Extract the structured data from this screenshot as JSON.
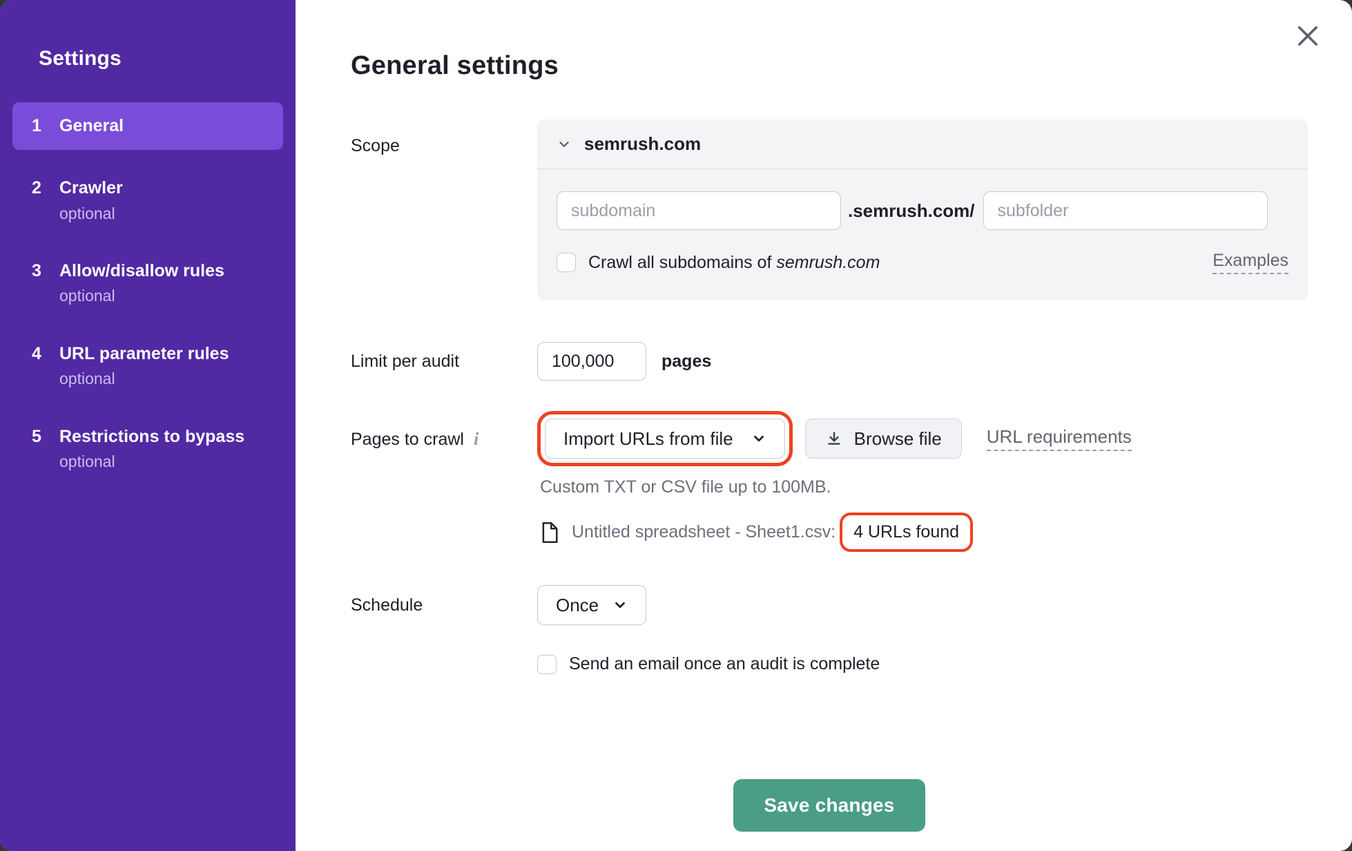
{
  "sidebar": {
    "title": "Settings",
    "items": [
      {
        "number": "1",
        "label": "General",
        "optional": "",
        "active": true
      },
      {
        "number": "2",
        "label": "Crawler",
        "optional": "optional",
        "active": false
      },
      {
        "number": "3",
        "label": "Allow/disallow rules",
        "optional": "optional",
        "active": false
      },
      {
        "number": "4",
        "label": "URL parameter rules",
        "optional": "optional",
        "active": false
      },
      {
        "number": "5",
        "label": "Restrictions to bypass",
        "optional": "optional",
        "active": false
      }
    ]
  },
  "header": {
    "title": "General settings"
  },
  "scope": {
    "label": "Scope",
    "domain": "semrush.com",
    "subdomain_placeholder": "subdomain",
    "domain_suffix": ".semrush.com/",
    "subfolder_placeholder": "subfolder",
    "crawl_all_prefix": "Crawl all subdomains of",
    "crawl_all_domain": "semrush.com",
    "crawl_all_checked": false,
    "examples_link": "Examples"
  },
  "limit": {
    "label": "Limit per audit",
    "value": "100,000",
    "unit": "pages"
  },
  "pages_to_crawl": {
    "label": "Pages to crawl",
    "info_icon_glyph": "i",
    "source_select_value": "Import URLs from file",
    "browse_button": "Browse file",
    "url_requirements_link": "URL requirements",
    "helper": "Custom TXT or CSV file up to 100MB.",
    "file_name": "Untitled spreadsheet - Sheet1.csv:",
    "file_result": "4 URLs found"
  },
  "schedule": {
    "label": "Schedule",
    "value": "Once",
    "email_checkbox_label": "Send an email once an audit is complete",
    "email_checkbox_checked": false
  },
  "footer": {
    "save_button": "Save changes"
  },
  "icons": {
    "close": "x-mark",
    "chevron_down": "chevron-down",
    "download": "arrow-down-to-line",
    "file": "document-page",
    "info": "italic-i"
  },
  "colors": {
    "sidebar_bg": "#5129A3",
    "sidebar_active_bg": "#7B4CD9",
    "annotation": "#EF4123",
    "save_btn": "#4A9D87",
    "panel_gray": "#F4F4F6"
  }
}
